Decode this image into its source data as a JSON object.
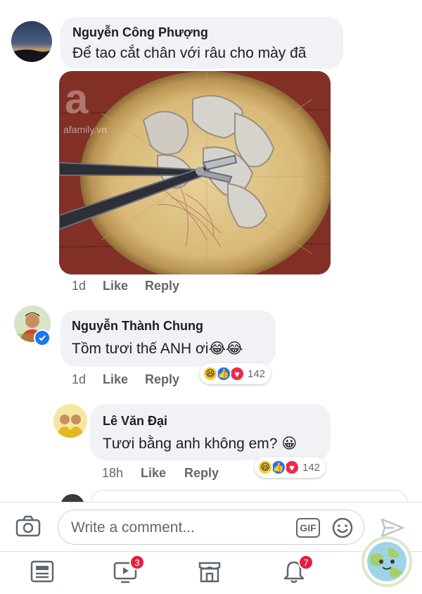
{
  "comments": [
    {
      "name": "Nguyễn Công Phượng",
      "text": "Để tao cắt chân với râu cho mày đã",
      "time": "1d",
      "like": "Like",
      "reply": "Reply",
      "photo_watermark": "afamily.vn"
    },
    {
      "name": "Nguyễn Thành Chung",
      "text": "Tồm tươi thế ANH ơi😂😂",
      "time": "1d",
      "like": "Like",
      "reply": "Reply",
      "reaction_count": "142"
    },
    {
      "name": "Lê Văn Đại",
      "text": "Tươi bằng anh không em? 😀",
      "time": "18h",
      "like": "Like",
      "reply": "Reply",
      "reaction_count": "142"
    }
  ],
  "composer": {
    "placeholder": "Write a comment...",
    "gif": "GIF"
  },
  "nav": {
    "video_badge": "3",
    "notifications_badge": "7"
  },
  "colors": {
    "accent": "#1877f2",
    "badge": "#e41e3f",
    "bubble": "#f0f2f5"
  }
}
